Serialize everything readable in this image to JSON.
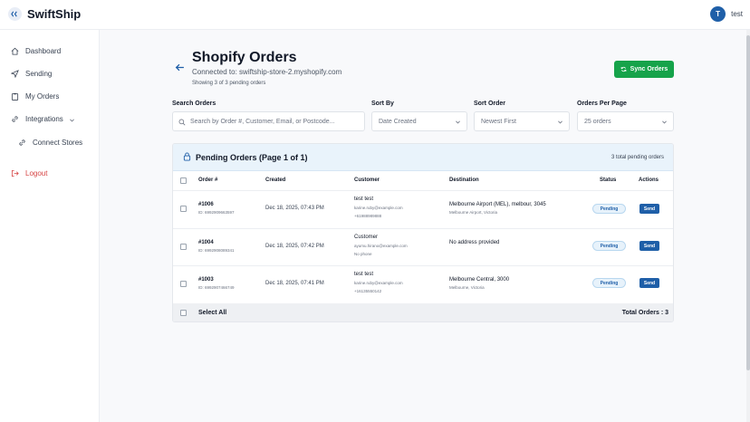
{
  "app": {
    "name": "SwiftShip"
  },
  "user": {
    "initial": "T",
    "name": "test"
  },
  "sidebar": {
    "items": [
      {
        "label": "Dashboard",
        "icon": "home-icon"
      },
      {
        "label": "Sending",
        "icon": "send-icon"
      },
      {
        "label": "My Orders",
        "icon": "clipboard-icon"
      },
      {
        "label": "Integrations",
        "icon": "link-icon"
      },
      {
        "label": "Connect Stores",
        "icon": "link-icon"
      },
      {
        "label": "Logout",
        "icon": "logout-icon"
      }
    ]
  },
  "header": {
    "title": "Shopify Orders",
    "connected": "Connected to: swiftship-store-2.myshopify.com",
    "showing": "Showing 3 of 3 pending orders",
    "sync_label": "Sync Orders"
  },
  "filters": {
    "search_label": "Search Orders",
    "search_placeholder": "Search by Order #, Customer, Email, or Postcode...",
    "sort_by_label": "Sort By",
    "sort_by_value": "Date Created",
    "sort_order_label": "Sort Order",
    "sort_order_value": "Newest First",
    "per_page_label": "Orders Per Page",
    "per_page_value": "25 orders"
  },
  "table": {
    "title": "Pending Orders (Page 1 of 1)",
    "total_pending": "3 total pending orders",
    "columns": [
      "Order #",
      "Created",
      "Customer",
      "Destination",
      "Status",
      "Actions"
    ],
    "rows": [
      {
        "order": "#1006",
        "id": "ID: 6992909663597",
        "created": "Dec 18, 2025, 07:43 PM",
        "customer": "test test",
        "email": "karine.ruby@example.com",
        "phone": "+61988989888",
        "dest": "Melbourne Airport (MEL), melbour, 3045",
        "dest_sub": "Melbourne Airport, Victoria",
        "status": "Pending",
        "action": "Send"
      },
      {
        "order": "#1004",
        "id": "ID: 6992908089341",
        "created": "Dec 18, 2025, 07:42 PM",
        "customer": "Customer",
        "email": "ayumu.hirano@example.com",
        "phone": "No phone",
        "dest": "No address provided",
        "dest_sub": "",
        "status": "Pending",
        "action": "Send"
      },
      {
        "order": "#1003",
        "id": "ID: 6992907466749",
        "created": "Dec 18, 2025, 07:41 PM",
        "customer": "test test",
        "email": "karine.ruby@example.com",
        "phone": "+16135550142",
        "dest": "Melbourne Central, 3000",
        "dest_sub": "Melbourne, Victoria",
        "status": "Pending",
        "action": "Send"
      }
    ],
    "select_all": "Select All",
    "total_orders": "Total Orders : 3"
  },
  "colors": {
    "primary": "#1f5fa8",
    "success": "#16a34a",
    "danger": "#d64545"
  }
}
